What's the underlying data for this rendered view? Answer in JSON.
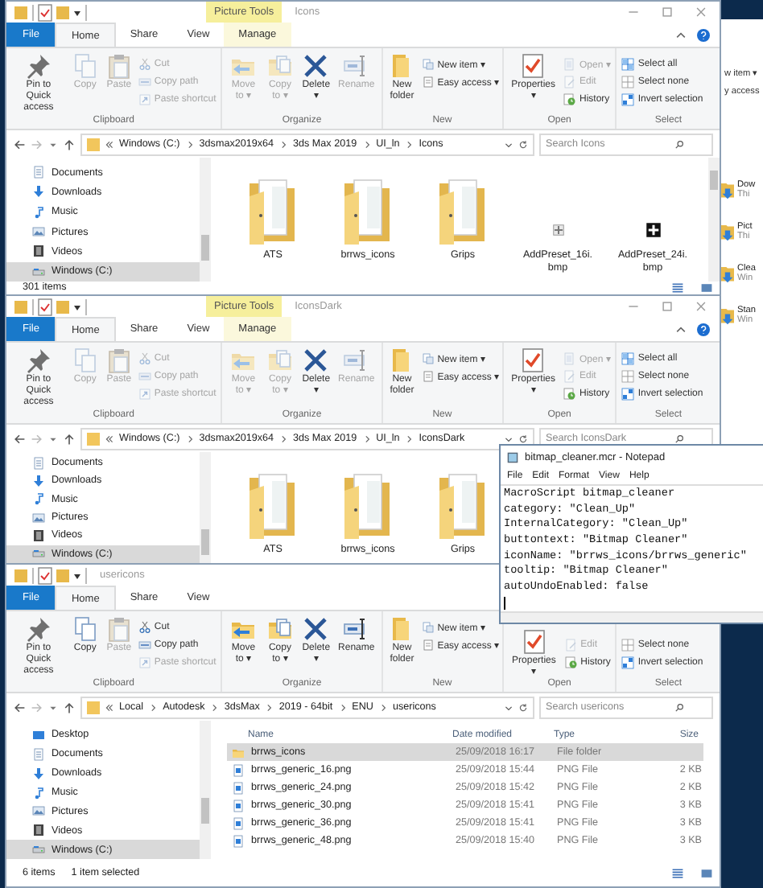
{
  "background_window": {
    "ribbon_fragments": [
      "w item ▾",
      "y access"
    ],
    "items": [
      {
        "title": "Dow",
        "subtitle": "Thi"
      },
      {
        "title": "Pict",
        "subtitle": "Thi"
      },
      {
        "title": "Clea",
        "subtitle": "Win"
      },
      {
        "title": "Stan",
        "subtitle": "Win"
      }
    ]
  },
  "windows": [
    {
      "title": "Icons",
      "context_tab": "Picture Tools",
      "window_controls": true,
      "tabs": [
        {
          "label": "File",
          "kind": "file",
          "selected": false
        },
        {
          "label": "Home",
          "kind": "tab",
          "selected": true
        },
        {
          "label": "Share",
          "kind": "tab",
          "selected": false
        },
        {
          "label": "View",
          "kind": "tab",
          "selected": false
        },
        {
          "label": "Manage",
          "kind": "tab",
          "selected": false
        }
      ],
      "ribbon": [
        {
          "label": "Clipboard",
          "big": [
            {
              "label": "Pin to Quick access",
              "kind": "pin",
              "disabled": false
            },
            {
              "label": "Copy",
              "kind": "copy",
              "disabled": true
            },
            {
              "label": "Paste",
              "kind": "paste",
              "disabled": true
            }
          ],
          "small": [
            {
              "label": "Cut",
              "kind": "cut",
              "disabled": true
            },
            {
              "label": "Copy path",
              "kind": "copypath",
              "disabled": true
            },
            {
              "label": "Paste shortcut",
              "kind": "shortcut",
              "disabled": true
            }
          ]
        },
        {
          "label": "Organize",
          "big": [
            {
              "label": "Move to ▾",
              "kind": "move",
              "disabled": true
            },
            {
              "label": "Copy to ▾",
              "kind": "copyto",
              "disabled": true
            },
            {
              "label": "Delete ▾",
              "kind": "delete",
              "disabled": false
            },
            {
              "label": "Rename",
              "kind": "rename",
              "disabled": true
            }
          ]
        },
        {
          "label": "New",
          "big": [
            {
              "label": "New folder",
              "kind": "newfolder",
              "disabled": false
            }
          ],
          "small": [
            {
              "label": "New item ▾",
              "kind": "newitem",
              "disabled": false
            },
            {
              "label": "Easy access ▾",
              "kind": "easy",
              "disabled": false
            }
          ]
        },
        {
          "label": "Open",
          "big": [
            {
              "label": "Properties ▾",
              "kind": "properties",
              "disabled": false
            }
          ],
          "small": [
            {
              "label": "Open ▾",
              "kind": "open",
              "disabled": true
            },
            {
              "label": "Edit",
              "kind": "edit",
              "disabled": true
            },
            {
              "label": "History",
              "kind": "history",
              "disabled": false
            }
          ]
        },
        {
          "label": "Select",
          "small": [
            {
              "label": "Select all",
              "kind": "selectall",
              "disabled": false
            },
            {
              "label": "Select none",
              "kind": "selectnone",
              "disabled": false
            },
            {
              "label": "Invert selection",
              "kind": "invert",
              "disabled": false
            }
          ]
        }
      ],
      "path": [
        "Windows (C:)",
        "3dsmax2019x64",
        "3ds Max 2019",
        "UI_ln",
        "Icons"
      ],
      "search": {
        "placeholder": "Search Icons"
      },
      "nav": [
        {
          "label": "Documents",
          "kind": "documents",
          "selected": false
        },
        {
          "label": "Downloads",
          "kind": "downloads",
          "selected": false
        },
        {
          "label": "Music",
          "kind": "music",
          "selected": false
        },
        {
          "label": "Pictures",
          "kind": "pictures",
          "selected": false
        },
        {
          "label": "Videos",
          "kind": "videos",
          "selected": false
        },
        {
          "label": "Windows (C:)",
          "kind": "drive",
          "selected": true
        }
      ],
      "content": {
        "kind": "icons",
        "items": [
          {
            "name": "ATS",
            "kind": "folder"
          },
          {
            "name": "brrws_icons",
            "kind": "folder"
          },
          {
            "name": "Grips",
            "kind": "folder"
          },
          {
            "name": "AddPreset_16i.bmp",
            "kind": "bmp-light"
          },
          {
            "name": "AddPreset_24i.bmp",
            "kind": "bmp-dark"
          }
        ]
      },
      "status": [
        "301 items"
      ]
    },
    {
      "title": "IconsDark",
      "context_tab": "Picture Tools",
      "window_controls": true,
      "tabs": [
        {
          "label": "File",
          "kind": "file",
          "selected": false
        },
        {
          "label": "Home",
          "kind": "tab",
          "selected": true
        },
        {
          "label": "Share",
          "kind": "tab",
          "selected": false
        },
        {
          "label": "View",
          "kind": "tab",
          "selected": false
        },
        {
          "label": "Manage",
          "kind": "tab",
          "selected": false
        }
      ],
      "ribbon": [
        {
          "label": "Clipboard",
          "big": [
            {
              "label": "Pin to Quick access",
              "kind": "pin",
              "disabled": false
            },
            {
              "label": "Copy",
              "kind": "copy",
              "disabled": true
            },
            {
              "label": "Paste",
              "kind": "paste",
              "disabled": true
            }
          ],
          "small": [
            {
              "label": "Cut",
              "kind": "cut",
              "disabled": true
            },
            {
              "label": "Copy path",
              "kind": "copypath",
              "disabled": true
            },
            {
              "label": "Paste shortcut",
              "kind": "shortcut",
              "disabled": true
            }
          ]
        },
        {
          "label": "Organize",
          "big": [
            {
              "label": "Move to ▾",
              "kind": "move",
              "disabled": true
            },
            {
              "label": "Copy to ▾",
              "kind": "copyto",
              "disabled": true
            },
            {
              "label": "Delete ▾",
              "kind": "delete",
              "disabled": false
            },
            {
              "label": "Rename",
              "kind": "rename",
              "disabled": true
            }
          ]
        },
        {
          "label": "New",
          "big": [
            {
              "label": "New folder",
              "kind": "newfolder",
              "disabled": false
            }
          ],
          "small": [
            {
              "label": "New item ▾",
              "kind": "newitem",
              "disabled": false
            },
            {
              "label": "Easy access ▾",
              "kind": "easy",
              "disabled": false
            }
          ]
        },
        {
          "label": "Open",
          "big": [
            {
              "label": "Properties ▾",
              "kind": "properties",
              "disabled": false
            }
          ],
          "small": [
            {
              "label": "Open ▾",
              "kind": "open",
              "disabled": true
            },
            {
              "label": "Edit",
              "kind": "edit",
              "disabled": true
            },
            {
              "label": "History",
              "kind": "history",
              "disabled": false
            }
          ]
        },
        {
          "label": "Select",
          "small": [
            {
              "label": "Select all",
              "kind": "selectall",
              "disabled": false
            },
            {
              "label": "Select none",
              "kind": "selectnone",
              "disabled": false
            },
            {
              "label": "Invert selection",
              "kind": "invert",
              "disabled": false
            }
          ]
        }
      ],
      "path": [
        "Windows (C:)",
        "3dsmax2019x64",
        "3ds Max 2019",
        "UI_ln",
        "IconsDark"
      ],
      "search": {
        "placeholder": "Search IconsDark"
      },
      "nav": [
        {
          "label": "Documents",
          "kind": "documents",
          "selected": false
        },
        {
          "label": "Downloads",
          "kind": "downloads",
          "selected": false
        },
        {
          "label": "Music",
          "kind": "music",
          "selected": false
        },
        {
          "label": "Pictures",
          "kind": "pictures",
          "selected": false
        },
        {
          "label": "Videos",
          "kind": "videos",
          "selected": false
        },
        {
          "label": "Windows (C:)",
          "kind": "drive",
          "selected": true
        }
      ],
      "content": {
        "kind": "icons",
        "items": [
          {
            "name": "ATS",
            "kind": "folder"
          },
          {
            "name": "brrws_icons",
            "kind": "folder"
          },
          {
            "name": "Grips",
            "kind": "folder"
          }
        ]
      }
    },
    {
      "title": "usericons",
      "window_controls": false,
      "tabs": [
        {
          "label": "File",
          "kind": "file",
          "selected": false
        },
        {
          "label": "Home",
          "kind": "tab",
          "selected": true
        },
        {
          "label": "Share",
          "kind": "tab",
          "selected": false
        },
        {
          "label": "View",
          "kind": "tab",
          "selected": false
        }
      ],
      "ribbon": [
        {
          "label": "Clipboard",
          "big": [
            {
              "label": "Pin to Quick access",
              "kind": "pin",
              "disabled": false
            },
            {
              "label": "Copy",
              "kind": "copy",
              "disabled": false
            },
            {
              "label": "Paste",
              "kind": "paste",
              "disabled": true
            }
          ],
          "small": [
            {
              "label": "Cut",
              "kind": "cut",
              "disabled": false
            },
            {
              "label": "Copy path",
              "kind": "copypath",
              "disabled": false
            },
            {
              "label": "Paste shortcut",
              "kind": "shortcut",
              "disabled": true
            }
          ]
        },
        {
          "label": "Organize",
          "big": [
            {
              "label": "Move to ▾",
              "kind": "move",
              "disabled": false
            },
            {
              "label": "Copy to ▾",
              "kind": "copyto",
              "disabled": false
            },
            {
              "label": "Delete ▾",
              "kind": "delete",
              "disabled": false
            },
            {
              "label": "Rename",
              "kind": "rename",
              "disabled": false
            }
          ]
        },
        {
          "label": "New",
          "big": [
            {
              "label": "New folder",
              "kind": "newfolder",
              "disabled": false
            }
          ],
          "small": [
            {
              "label": "New item ▾",
              "kind": "newitem",
              "disabled": false
            },
            {
              "label": "Easy access ▾",
              "kind": "easy",
              "disabled": false
            }
          ]
        },
        {
          "label": "Open",
          "big": [
            {
              "label": "Properties ▾",
              "kind": "properties",
              "disabled": false
            }
          ],
          "small": [
            {
              "label": "Edit",
              "kind": "edit",
              "disabled": true
            },
            {
              "label": "History",
              "kind": "history",
              "disabled": false
            }
          ]
        },
        {
          "label": "Select",
          "small": [
            {
              "label": "Select none",
              "kind": "selectnone",
              "disabled": false
            },
            {
              "label": "Invert selection",
              "kind": "invert",
              "disabled": false
            }
          ]
        }
      ],
      "path": [
        "Local",
        "Autodesk",
        "3dsMax",
        "2019 - 64bit",
        "ENU",
        "usericons"
      ],
      "search": {
        "placeholder": "Search usericons"
      },
      "nav": [
        {
          "label": "Desktop",
          "kind": "desktop",
          "selected": false
        },
        {
          "label": "Documents",
          "kind": "documents",
          "selected": false
        },
        {
          "label": "Downloads",
          "kind": "downloads",
          "selected": false
        },
        {
          "label": "Music",
          "kind": "music",
          "selected": false
        },
        {
          "label": "Pictures",
          "kind": "pictures",
          "selected": false
        },
        {
          "label": "Videos",
          "kind": "videos",
          "selected": false
        },
        {
          "label": "Windows (C:)",
          "kind": "drive",
          "selected": true
        }
      ],
      "content": {
        "kind": "details",
        "columns": [
          "Name",
          "Date modified",
          "Type",
          "Size"
        ],
        "rows": [
          {
            "name": "brrws_icons",
            "date": "25/09/2018 16:17",
            "type": "File folder",
            "kind": "folder",
            "selected": true
          },
          {
            "name": "brrws_generic_16.png",
            "date": "25/09/2018 15:44",
            "type": "PNG File",
            "size": "2 KB",
            "kind": "png",
            "selected": false
          },
          {
            "name": "brrws_generic_24.png",
            "date": "25/09/2018 15:42",
            "type": "PNG File",
            "size": "2 KB",
            "kind": "png",
            "selected": false
          },
          {
            "name": "brrws_generic_30.png",
            "date": "25/09/2018 15:41",
            "type": "PNG File",
            "size": "3 KB",
            "kind": "png",
            "selected": false
          },
          {
            "name": "brrws_generic_36.png",
            "date": "25/09/2018 15:41",
            "type": "PNG File",
            "size": "3 KB",
            "kind": "png",
            "selected": false
          },
          {
            "name": "brrws_generic_48.png",
            "date": "25/09/2018 15:40",
            "type": "PNG File",
            "size": "3 KB",
            "kind": "png",
            "selected": false
          }
        ]
      },
      "status": [
        "6 items",
        "1 item selected"
      ]
    }
  ],
  "notepad": {
    "title": "bitmap_cleaner.mcr - Notepad",
    "menu": [
      "File",
      "Edit",
      "Format",
      "View",
      "Help"
    ],
    "lines": [
      "MacroScript bitmap_cleaner",
      "category: \"Clean_Up\"",
      "InternalCategory: \"Clean_Up\"",
      "buttontext: \"Bitmap Cleaner\"",
      "iconName: \"brrws_icons/brrws_generic\"",
      "tooltip: \"Bitmap Cleaner\"",
      "autoUndoEnabled: false"
    ]
  }
}
